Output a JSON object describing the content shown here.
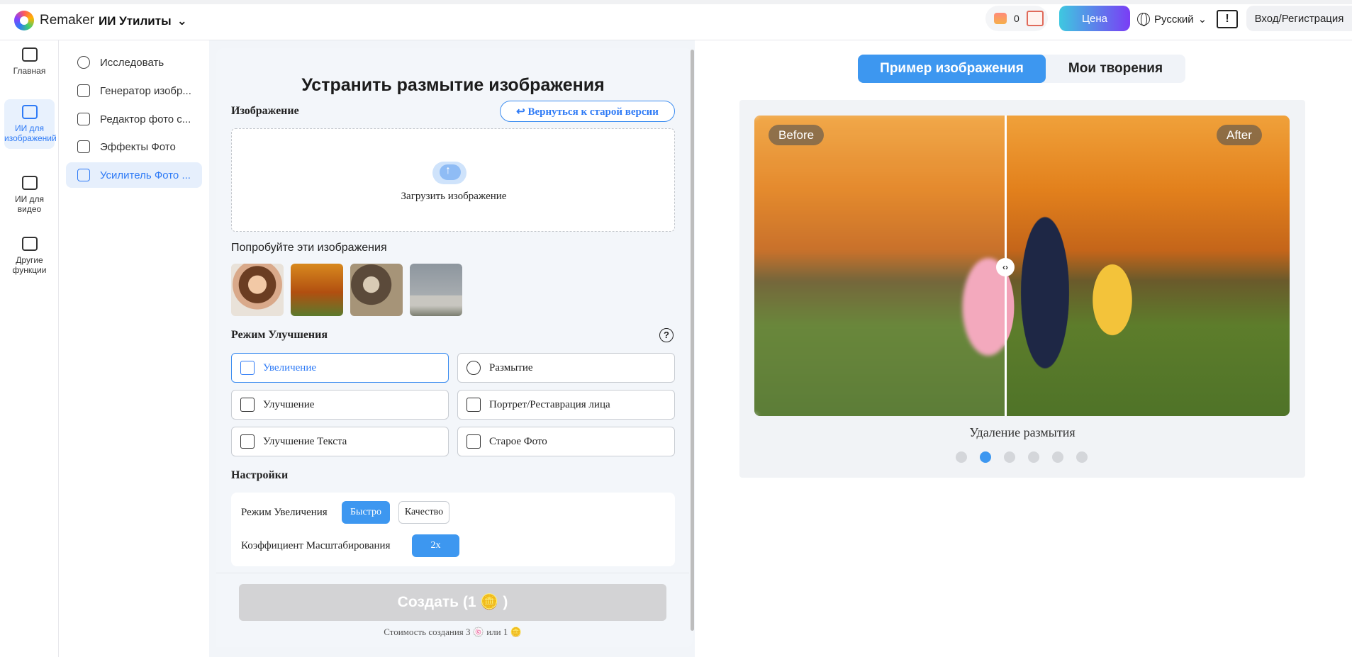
{
  "header": {
    "logo_text": "Remaker",
    "tools_menu": "ИИ Утилиты",
    "credits": "0",
    "price_button": "Цена",
    "language": "Русский",
    "login_button": "Вход/Регистрация"
  },
  "rail": {
    "items": [
      {
        "label": "Главная"
      },
      {
        "label": "ИИ для изображений"
      },
      {
        "label": "ИИ для видео"
      },
      {
        "label": "Другие функции"
      }
    ]
  },
  "subnav": {
    "items": [
      {
        "label": "Исследовать"
      },
      {
        "label": "Генератор изобр..."
      },
      {
        "label": "Редактор фото с..."
      },
      {
        "label": "Эффекты Фото"
      },
      {
        "label": "Усилитель Фото ..."
      }
    ]
  },
  "panel": {
    "title": "Устранить размытие изображения",
    "image_label": "Изображение",
    "old_version_button": "Вернуться к старой версии",
    "upload_text": "Загрузить изображение",
    "try_label": "Попробуйте эти изображения",
    "mode_label": "Режим Улучшения",
    "modes": [
      {
        "label": "Увеличение"
      },
      {
        "label": "Размытие"
      },
      {
        "label": "Улучшение"
      },
      {
        "label": "Портрет/Реставрация лица"
      },
      {
        "label": "Улучшение Текста"
      },
      {
        "label": "Старое Фото"
      }
    ],
    "settings_label": "Настройки",
    "upscale_mode_label": "Режим Увеличения",
    "upscale_fast": "Быстро",
    "upscale_quality": "Качество",
    "scale_factor_label": "Коэффициент Масштабирования",
    "scale_factor_value": "2x",
    "create_button": "Создать (1 🪙 )",
    "cost_text": "Стоимость создания 3 🍥 или 1 🪙"
  },
  "preview": {
    "tabs": [
      {
        "label": "Пример изображения"
      },
      {
        "label": "Мои творения"
      }
    ],
    "before_tag": "Before",
    "after_tag": "After",
    "caption": "Удаление размытия",
    "active_slide": 2,
    "slide_count": 6
  },
  "colors": {
    "accent": "#3d97f0",
    "price_gradient_start": "#3ec8e0",
    "price_gradient_end": "#7a3df5"
  }
}
